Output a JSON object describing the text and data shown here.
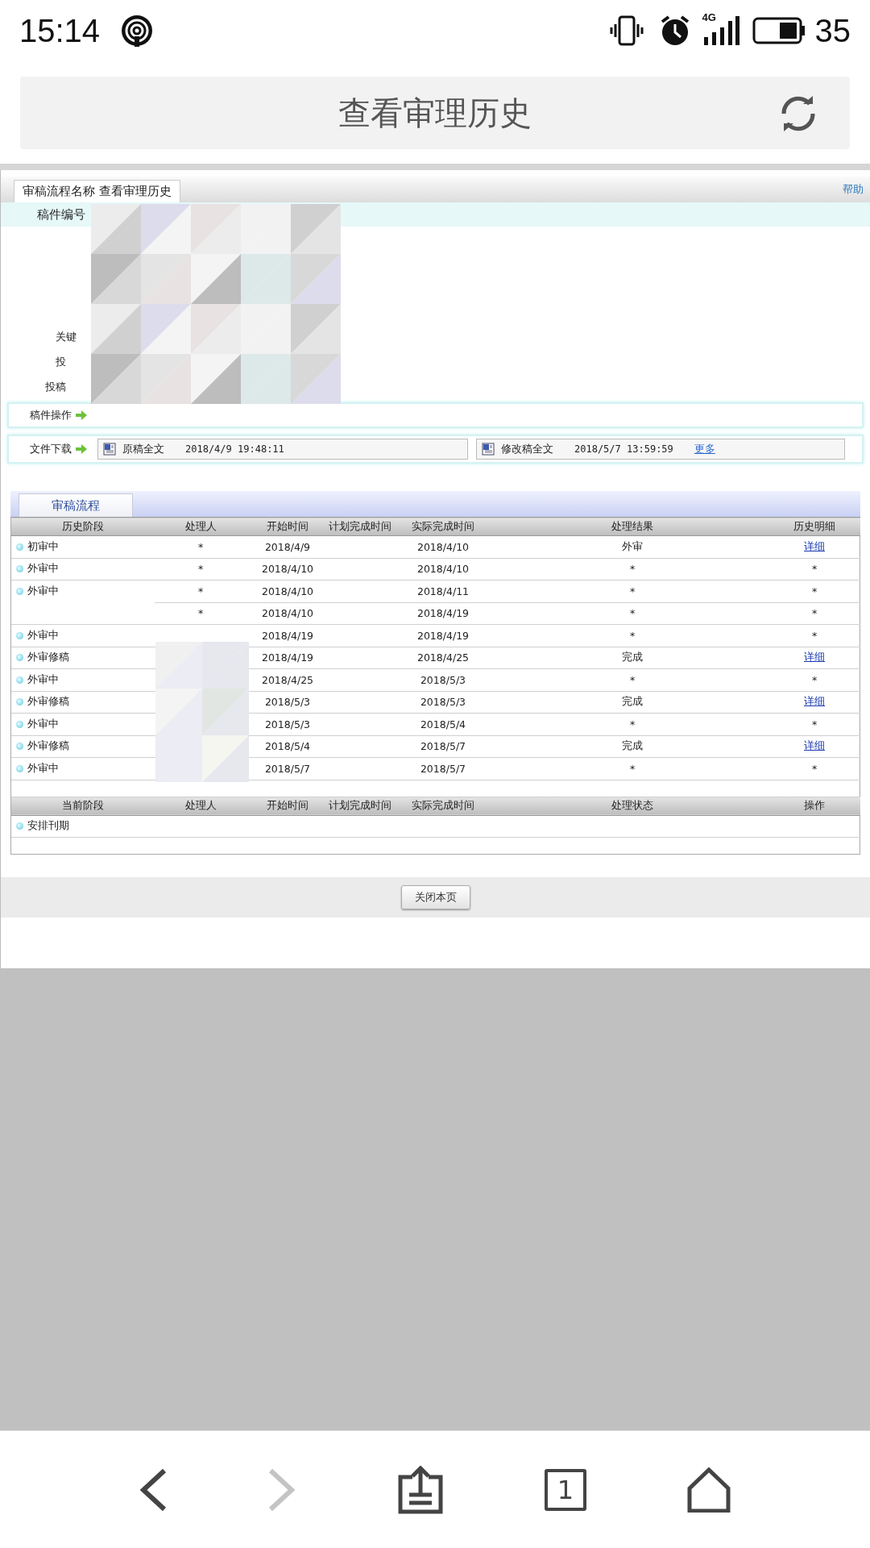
{
  "status_bar": {
    "time": "15:14",
    "network": "4G",
    "battery": "35"
  },
  "title_bar": {
    "title": "查看审理历史"
  },
  "page": {
    "header_tab": "审稿流程名称 查看审理历史",
    "help": "帮助",
    "manuscript_label": "稿件编号",
    "partial_labels": [
      "关键",
      "投",
      "投稿"
    ],
    "operations_label": "稿件操作",
    "download_label": "文件下载",
    "files": [
      {
        "name": "原稿全文",
        "time": "2018/4/9 19:48:11"
      },
      {
        "name": "修改稿全文",
        "time": "2018/5/7 13:59:59",
        "more": "更多"
      }
    ],
    "section_tab": "审稿流程",
    "history_columns": [
      "历史阶段",
      "处理人",
      "开始时间",
      "计划完成时间",
      "实际完成时间",
      "处理结果",
      "历史明细"
    ],
    "history_rows": [
      {
        "stage": "初审中",
        "handler": "*",
        "start": "2018/4/9",
        "actual": "2018/4/10",
        "result": "外审",
        "detail": "详细",
        "detail_link": true
      },
      {
        "stage": "外审中",
        "handler": "*",
        "start": "2018/4/10",
        "actual": "2018/4/10",
        "result": "*",
        "detail": "*",
        "detail_link": false
      },
      {
        "stage": "外审中",
        "handler": "*",
        "start": "2018/4/10",
        "actual": "2018/4/11",
        "result": "*",
        "detail": "*",
        "detail_link": false
      },
      {
        "handler": "*",
        "start": "2018/4/10",
        "actual": "2018/4/19",
        "result": "*",
        "detail": "*",
        "detail_link": false
      },
      {
        "stage": "外审中",
        "start": "2018/4/19",
        "actual": "2018/4/19",
        "result": "*",
        "detail": "*",
        "detail_link": false
      },
      {
        "stage": "外审修稿",
        "start": "2018/4/19",
        "actual": "2018/4/25",
        "result": "完成",
        "detail": "详细",
        "detail_link": true
      },
      {
        "stage": "外审中",
        "start": "2018/4/25",
        "actual": "2018/5/3",
        "result": "*",
        "detail": "*",
        "detail_link": false
      },
      {
        "stage": "外审修稿",
        "start": "2018/5/3",
        "actual": "2018/5/3",
        "result": "完成",
        "detail": "详细",
        "detail_link": true
      },
      {
        "stage": "外审中",
        "start": "2018/5/3",
        "actual": "2018/5/4",
        "result": "*",
        "detail": "*",
        "detail_link": false
      },
      {
        "stage": "外审修稿",
        "start": "2018/5/4",
        "actual": "2018/5/7",
        "result": "完成",
        "detail": "详细",
        "detail_link": true
      },
      {
        "stage": "外审中",
        "start": "2018/5/7",
        "actual": "2018/5/7",
        "result": "*",
        "detail": "*",
        "detail_link": false
      }
    ],
    "current_columns": [
      "当前阶段",
      "处理人",
      "开始时间",
      "计划完成时间",
      "实际完成时间",
      "处理状态",
      "操作"
    ],
    "current_rows": [
      {
        "stage": "安排刊期"
      }
    ],
    "close_button": "关闭本页"
  },
  "nav_bar": {
    "tab_count": "1"
  }
}
